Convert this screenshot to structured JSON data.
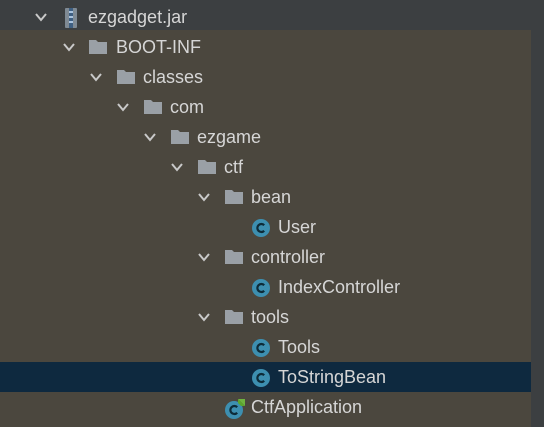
{
  "tree": {
    "items": [
      {
        "label": "ezgadget.jar",
        "icon": "jar-archive-icon",
        "expanded": true,
        "selected": false
      },
      {
        "label": "BOOT-INF",
        "icon": "folder-icon",
        "expanded": true,
        "selected": false
      },
      {
        "label": "classes",
        "icon": "folder-icon",
        "expanded": true,
        "selected": false
      },
      {
        "label": "com",
        "icon": "folder-icon",
        "expanded": true,
        "selected": false
      },
      {
        "label": "ezgame",
        "icon": "folder-icon",
        "expanded": true,
        "selected": false
      },
      {
        "label": "ctf",
        "icon": "folder-icon",
        "expanded": true,
        "selected": false
      },
      {
        "label": "bean",
        "icon": "folder-icon",
        "expanded": true,
        "selected": false
      },
      {
        "label": "User",
        "icon": "java-class-icon",
        "selected": false
      },
      {
        "label": "controller",
        "icon": "folder-icon",
        "expanded": true,
        "selected": false
      },
      {
        "label": "IndexController",
        "icon": "java-class-icon",
        "selected": false
      },
      {
        "label": "tools",
        "icon": "folder-icon",
        "expanded": true,
        "selected": false
      },
      {
        "label": "Tools",
        "icon": "java-class-icon",
        "selected": false
      },
      {
        "label": "ToStringBean",
        "icon": "java-class-icon",
        "selected": true
      },
      {
        "label": "CtfApplication",
        "icon": "spring-boot-class-icon",
        "selected": false
      }
    ]
  },
  "colors": {
    "background": "#4b473e",
    "selection": "#0e293f",
    "text": "#d6d6d6",
    "folder": "#9aa0a6",
    "class_badge": "#3d8fb0",
    "spring_badge": "#6db33f"
  }
}
